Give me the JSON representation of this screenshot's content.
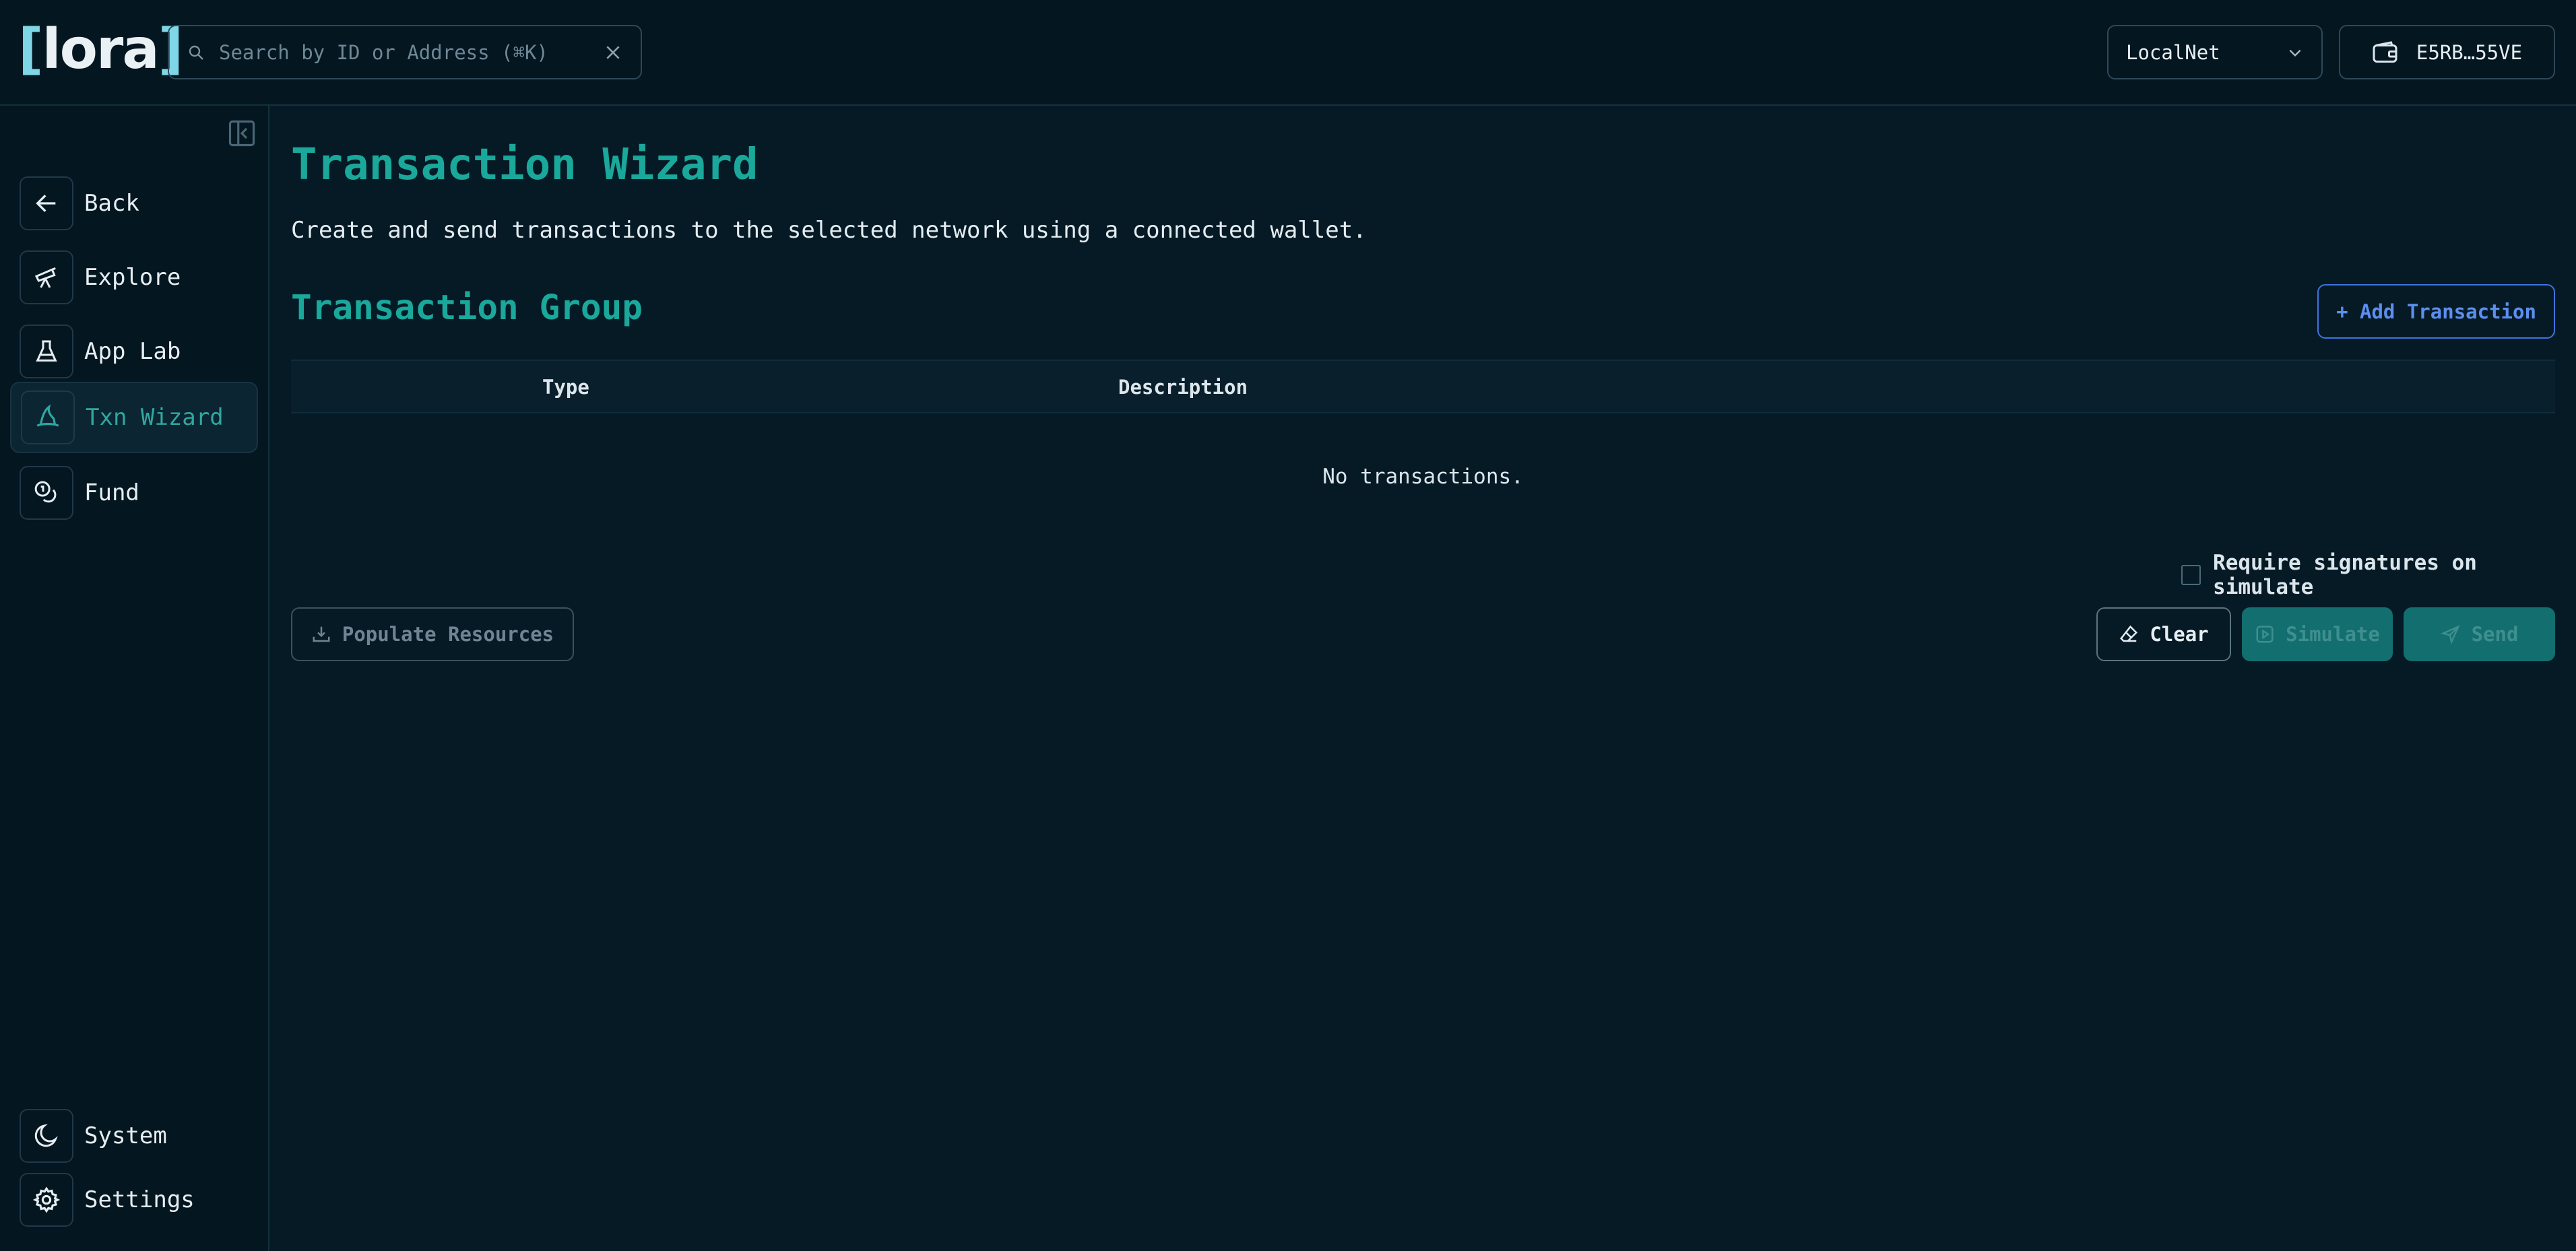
{
  "header": {
    "logo": {
      "open": "[",
      "text": "lora",
      "close": "]"
    },
    "search": {
      "placeholder": "Search by ID or Address (⌘K)",
      "value": ""
    },
    "network": {
      "selected": "LocalNet"
    },
    "wallet": {
      "label": "E5RB…55VE"
    }
  },
  "sidebar": {
    "items": [
      {
        "label": "Back",
        "icon": "arrow-left-icon",
        "active": false
      },
      {
        "label": "Explore",
        "icon": "telescope-icon",
        "active": false
      },
      {
        "label": "App Lab",
        "icon": "flask-icon",
        "active": false
      },
      {
        "label": "Txn Wizard",
        "icon": "wizard-hat-icon",
        "active": true
      },
      {
        "label": "Fund",
        "icon": "coins-icon",
        "active": false
      }
    ],
    "bottom": [
      {
        "label": "System",
        "icon": "moon-icon"
      },
      {
        "label": "Settings",
        "icon": "gear-icon"
      }
    ]
  },
  "main": {
    "title": "Transaction Wizard",
    "subtitle": "Create and send transactions to the selected network using a connected wallet.",
    "group_title": "Transaction Group",
    "add_button": "+ Add Transaction",
    "table": {
      "columns": [
        "Type",
        "Description"
      ],
      "empty": "No transactions."
    },
    "require_signatures": {
      "label": "Require signatures on simulate",
      "checked": false
    },
    "buttons": {
      "populate": "Populate Resources",
      "clear": "Clear",
      "simulate": "Simulate",
      "send": "Send"
    }
  },
  "colors": {
    "background": "#061a26",
    "accent": "#1aa89b",
    "link_blue": "#5b8ff0",
    "button_teal": "#136e6f"
  }
}
